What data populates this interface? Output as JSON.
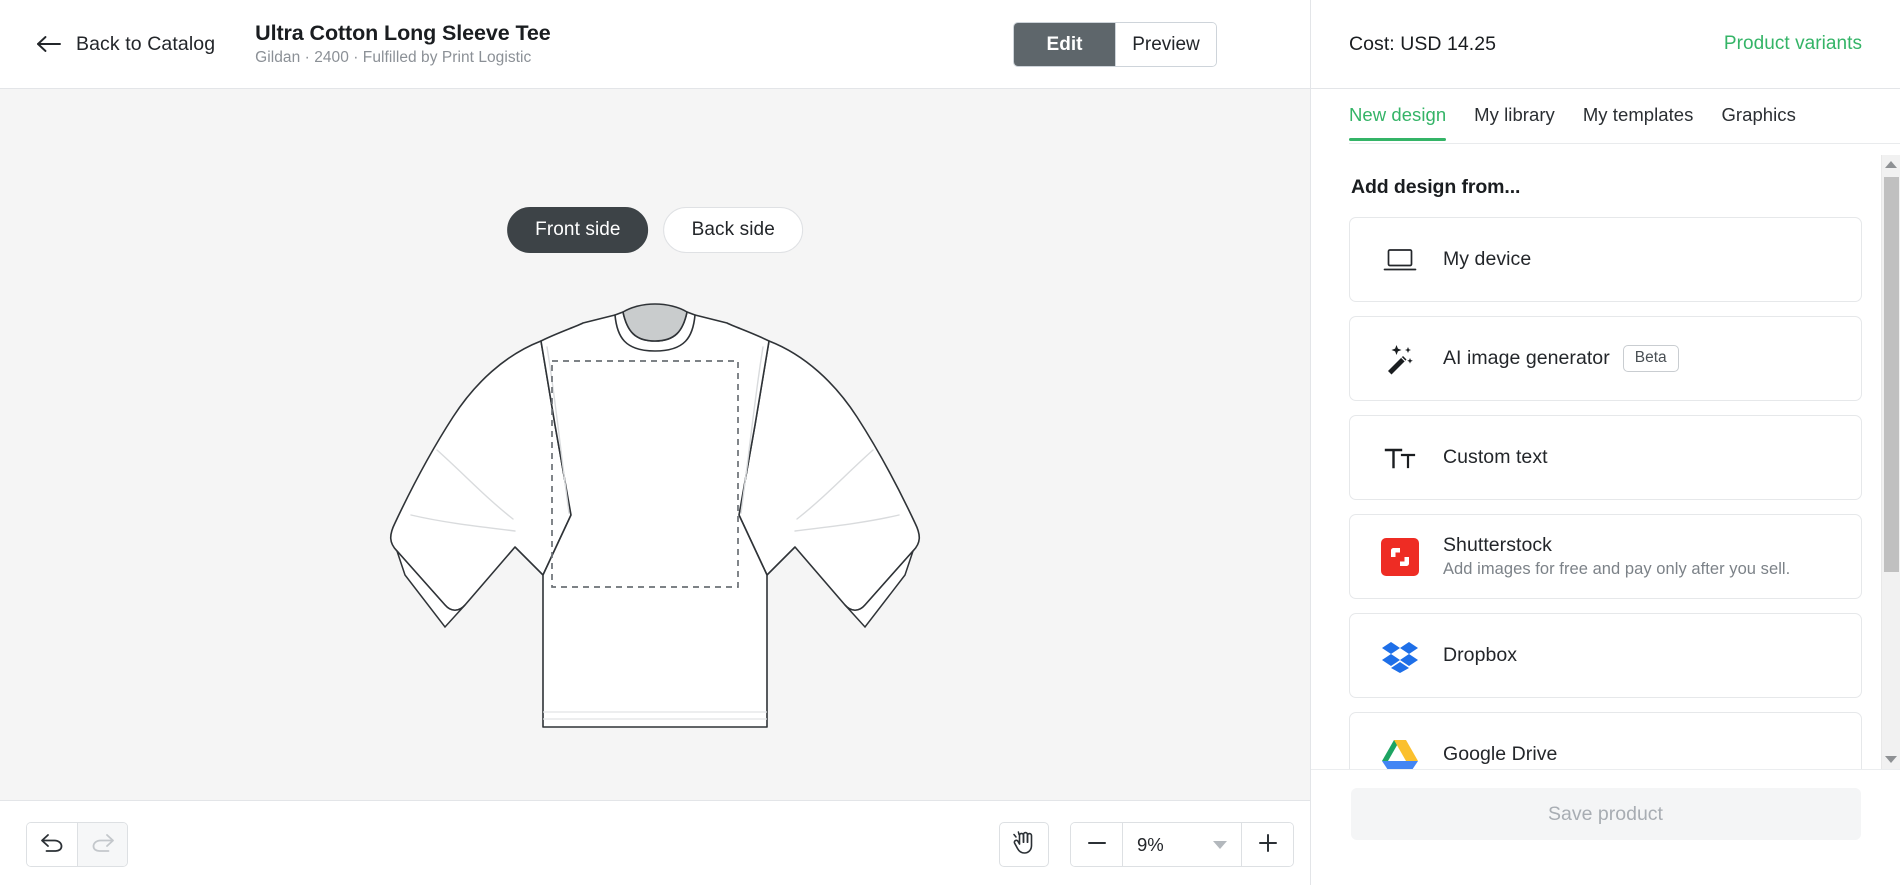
{
  "header": {
    "back_label": "Back to Catalog",
    "product_title": "Ultra Cotton Long Sleeve Tee",
    "product_subtitle": "Gildan · 2400 · Fulfilled by Print Logistic",
    "mode_tabs": [
      {
        "label": "Edit",
        "active": true
      },
      {
        "label": "Preview",
        "active": false
      }
    ]
  },
  "canvas": {
    "side_tabs": [
      {
        "label": "Front side",
        "active": true
      },
      {
        "label": "Back side",
        "active": false
      }
    ],
    "mockup_name": "long-sleeve-tee-front-mockup",
    "print_area_label": "print-area-dashed-outline"
  },
  "bottom_toolbar": {
    "undo_icon": "undo-arrow-icon",
    "redo_icon": "redo-arrow-icon",
    "redo_disabled": true,
    "pan_icon": "hand-pan-icon",
    "zoom_out_label": "−",
    "zoom_in_label": "+",
    "zoom_value": "9%"
  },
  "right_panel": {
    "cost_label": "Cost: USD 14.25",
    "variants_link": "Product variants",
    "tabs": [
      {
        "label": "New design",
        "active": true
      },
      {
        "label": "My library",
        "active": false
      },
      {
        "label": "My templates",
        "active": false
      },
      {
        "label": "Graphics",
        "active": false
      }
    ],
    "section_title": "Add design from...",
    "sources": [
      {
        "title": "My device",
        "desc": "",
        "badge": "",
        "icon": "laptop-icon"
      },
      {
        "title": "AI image generator",
        "desc": "",
        "badge": "Beta",
        "icon": "magic-wand-icon"
      },
      {
        "title": "Custom text",
        "desc": "",
        "badge": "",
        "icon": "text-tt-icon"
      },
      {
        "title": "Shutterstock",
        "desc": "Add images for free and pay only after you sell.",
        "badge": "",
        "icon": "shutterstock-icon"
      },
      {
        "title": "Dropbox",
        "desc": "",
        "badge": "",
        "icon": "dropbox-icon"
      },
      {
        "title": "Google Drive",
        "desc": "",
        "badge": "",
        "icon": "google-drive-icon"
      }
    ],
    "save_button": "Save product",
    "scrollbar": "vertical-scrollbar"
  },
  "colors": {
    "accent_green": "#34b467",
    "active_dark": "#3d4347",
    "mode_active": "#5e666b",
    "canvas_bg": "#f5f5f5",
    "shutterstock_red": "#ee2c24",
    "dropbox_blue": "#1e6fe8"
  }
}
